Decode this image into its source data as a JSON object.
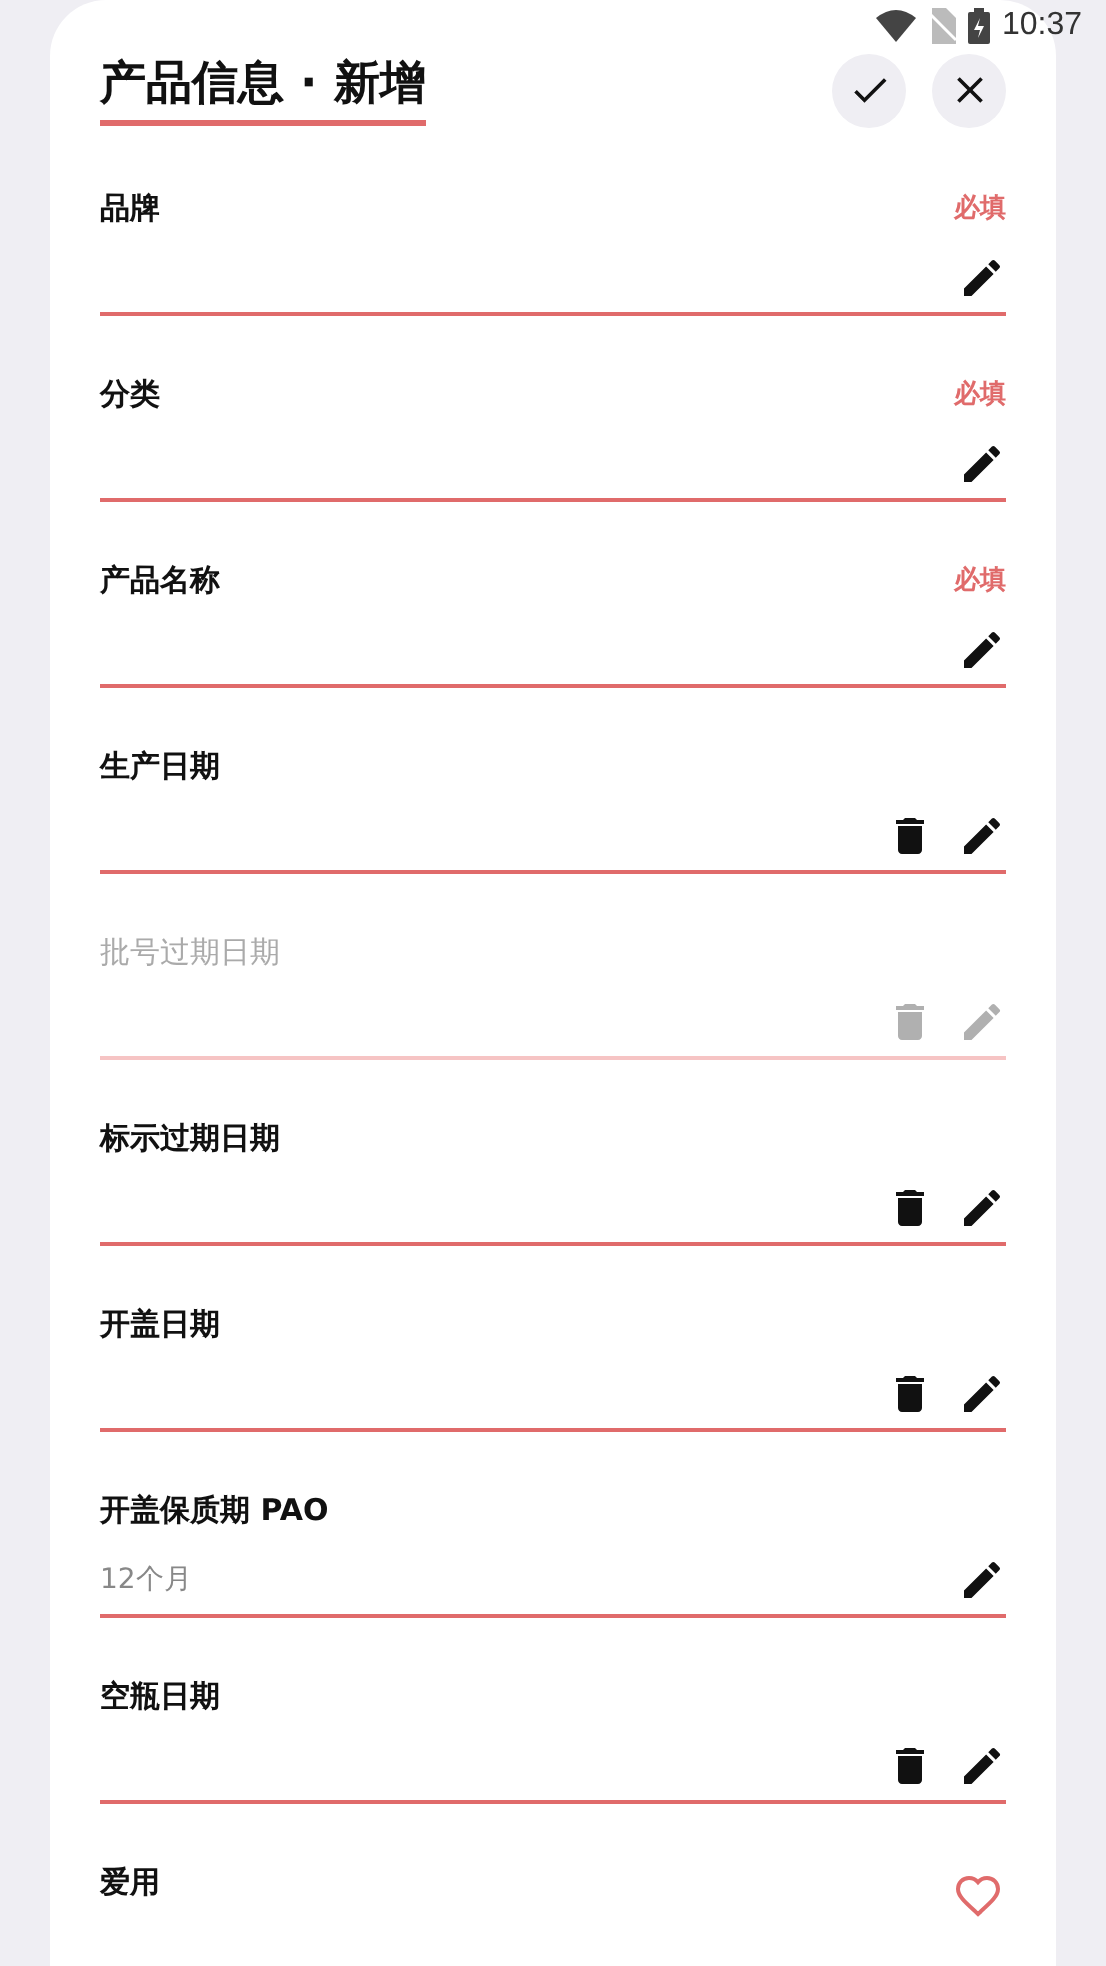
{
  "status_bar": {
    "time": "10:37"
  },
  "header": {
    "title": "产品信息 · 新增"
  },
  "fields": [
    {
      "kind": "text",
      "label": "品牌",
      "badge": "必填",
      "disabled": false,
      "deletable": false
    },
    {
      "kind": "text",
      "label": "分类",
      "badge": "必填",
      "disabled": false,
      "deletable": false
    },
    {
      "kind": "text",
      "label": "产品名称",
      "badge": "必填",
      "disabled": false,
      "deletable": false
    },
    {
      "kind": "text",
      "label": "生产日期",
      "disabled": false,
      "deletable": true
    },
    {
      "kind": "text",
      "label": "批号过期日期",
      "disabled": true,
      "deletable": true
    },
    {
      "kind": "text",
      "label": "标示过期日期",
      "disabled": false,
      "deletable": true
    },
    {
      "kind": "text",
      "label": "开盖日期",
      "disabled": false,
      "deletable": true
    },
    {
      "kind": "text",
      "label": "开盖保质期 PAO",
      "value": "12个月",
      "disabled": false,
      "deletable": false
    },
    {
      "kind": "text",
      "label": "空瓶日期",
      "disabled": false,
      "deletable": true
    },
    {
      "kind": "favorite",
      "label": "爱用"
    }
  ]
}
